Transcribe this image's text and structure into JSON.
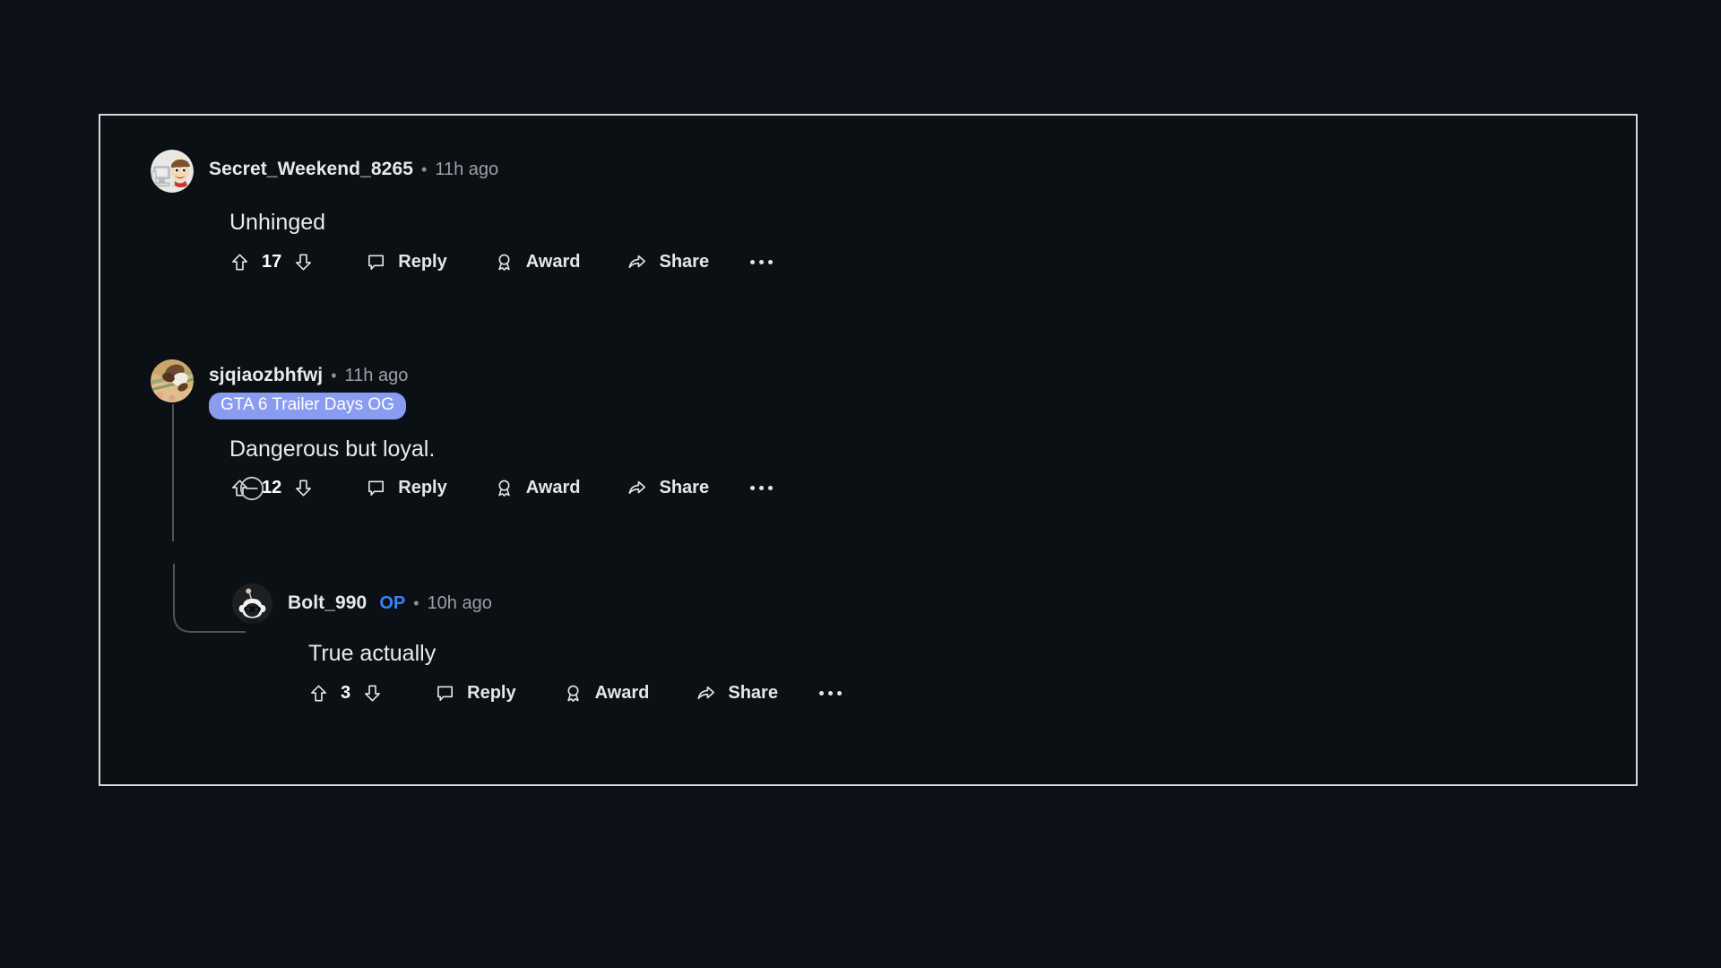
{
  "page": {
    "background_color": "#0d1117",
    "panel_background_color": "#0b1014",
    "frame_border_color": "#d4d8dd"
  },
  "theme": {
    "text_primary": "#e9eaec",
    "text_muted": "#9aa0a6",
    "op_color": "#3b82f7",
    "flair_background": "#8a9cf0",
    "flair_text": "#ffffff",
    "thread_line": "#4e5458"
  },
  "comments": [
    {
      "id": "comment-1",
      "username": "Secret_Weekend_8265",
      "separator": "•",
      "timestamp": "11h ago",
      "is_op": false,
      "op_label": "",
      "flair": "",
      "body": "Unhinged",
      "score": "17",
      "avatar_name": "avatar-woody",
      "actions": {
        "upvote": "upvote-icon",
        "downvote": "downvote-icon",
        "reply_label": "Reply",
        "award_label": "Award",
        "share_label": "Share",
        "overflow_label": "•••"
      }
    },
    {
      "id": "comment-2",
      "username": "sjqiaozbhfwj",
      "separator": "•",
      "timestamp": "11h ago",
      "is_op": false,
      "op_label": "",
      "flair": "GTA 6 Trailer Days OG",
      "body": "Dangerous but loyal.",
      "score": "12",
      "avatar_name": "avatar-photo",
      "actions": {
        "upvote": "upvote-icon",
        "downvote": "downvote-icon",
        "reply_label": "Reply",
        "award_label": "Award",
        "share_label": "Share",
        "overflow_label": "•••"
      }
    },
    {
      "id": "comment-3",
      "username": "Bolt_990",
      "separator": "•",
      "timestamp": "10h ago",
      "is_op": true,
      "op_label": "OP",
      "flair": "",
      "body": "True actually",
      "score": "3",
      "avatar_name": "avatar-snoo",
      "actions": {
        "upvote": "upvote-icon",
        "downvote": "downvote-icon",
        "reply_label": "Reply",
        "award_label": "Award",
        "share_label": "Share",
        "overflow_label": "•••"
      }
    }
  ]
}
